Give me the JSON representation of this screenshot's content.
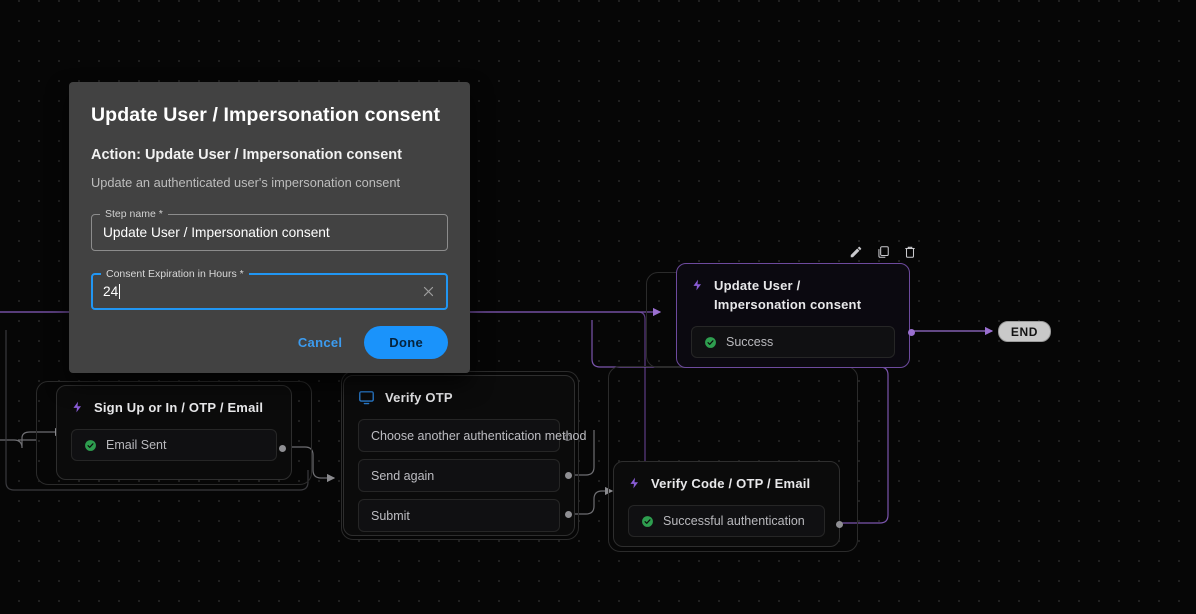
{
  "modal": {
    "title": "Update User / Impersonation consent",
    "action_line": "Action: Update User / Impersonation consent",
    "description": "Update an authenticated user's impersonation consent",
    "fields": [
      {
        "label": "Step name *",
        "value": "Update User / Impersonation consent",
        "focused": false
      },
      {
        "label": "Consent Expiration in Hours *",
        "value": "24",
        "focused": true
      }
    ],
    "clear_icon": "close-x-icon",
    "cancel_label": "Cancel",
    "done_label": "Done",
    "accent_color": "#1a93fb",
    "surface_color": "#424242"
  },
  "node_toolbar": {
    "edit_icon": "pencil-icon",
    "duplicate_icon": "copy-icon",
    "delete_icon": "trash-icon"
  },
  "flow": {
    "end_label": "END",
    "nodes": [
      {
        "id": "update-user-impersonation-consent",
        "title": "Update User / Impersonation consent",
        "icon": "lightning-bolt-icon",
        "accent": "#8a5cd6",
        "rows": [
          {
            "label": "Success",
            "icon": "check-circle-icon"
          }
        ]
      },
      {
        "id": "sign-up-or-in-otp-email",
        "title": "Sign Up or In / OTP / Email",
        "icon": "lightning-bolt-icon",
        "accent": "#8a5cd6",
        "rows": [
          {
            "label": "Email Sent",
            "icon": "check-circle-icon"
          }
        ]
      },
      {
        "id": "verify-otp",
        "title": "Verify OTP",
        "icon": "screen-icon",
        "accent": "#2878c8",
        "rows": [
          {
            "label": "Choose another authentication method",
            "icon": "none"
          },
          {
            "label": "Send again",
            "icon": "none"
          },
          {
            "label": "Submit",
            "icon": "none"
          }
        ]
      },
      {
        "id": "verify-code-otp-email",
        "title": "Verify Code / OTP / Email",
        "icon": "lightning-bolt-icon",
        "accent": "#8a5cd6",
        "rows": [
          {
            "label": "Successful authentication",
            "icon": "check-circle-icon"
          }
        ]
      }
    ]
  }
}
